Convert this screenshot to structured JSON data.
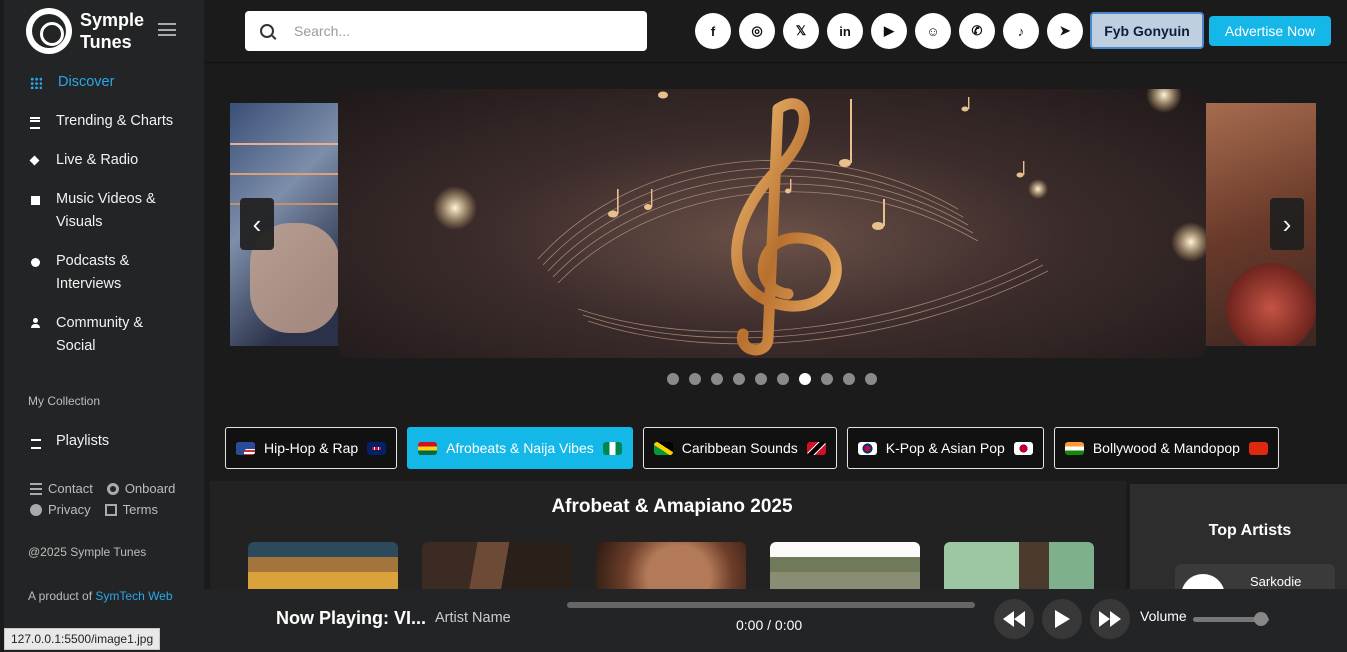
{
  "app": {
    "name_line1": "Symple",
    "name_line2": "Tunes"
  },
  "sidebar": {
    "items": [
      {
        "label": "Discover",
        "icon": "grid-icon"
      },
      {
        "label": "Trending & Charts",
        "icon": "list-icon"
      },
      {
        "label": "Live & Radio",
        "icon": "radio-icon"
      },
      {
        "label": "Music Videos & Visuals",
        "icon": "video-icon"
      },
      {
        "label": "Podcasts & Interviews",
        "icon": "podcast-icon"
      },
      {
        "label": "Community & Social",
        "icon": "user-icon"
      }
    ],
    "collection_label": "My Collection",
    "playlists_label": "Playlists",
    "links": {
      "contact": "Contact",
      "onboard": "Onboard",
      "privacy": "Privacy",
      "terms": "Terms"
    },
    "copyright": "@2025 Symple Tunes",
    "product_prefix": "A product of ",
    "product_link": "SymTech Web"
  },
  "search": {
    "placeholder": "Search..."
  },
  "socials": [
    {
      "name": "facebook-icon",
      "glyph": "f"
    },
    {
      "name": "instagram-icon",
      "glyph": "◎"
    },
    {
      "name": "x-icon",
      "glyph": "𝕏"
    },
    {
      "name": "linkedin-icon",
      "glyph": "in"
    },
    {
      "name": "youtube-icon",
      "glyph": "▶"
    },
    {
      "name": "snapchat-icon",
      "glyph": "☺"
    },
    {
      "name": "whatsapp-icon",
      "glyph": "✆"
    },
    {
      "name": "tiktok-icon",
      "glyph": "♪"
    },
    {
      "name": "telegram-icon",
      "glyph": "➤"
    }
  ],
  "header": {
    "user_button": "Fyb Gonyuin",
    "advertise_button": "Advertise Now"
  },
  "carousel": {
    "prev": "‹",
    "next": "›",
    "slide_count": 10,
    "active_index": 6
  },
  "genres": [
    {
      "label": "Hip-Hop & Rap",
      "active": false
    },
    {
      "label": "Afrobeats & Naija Vibes",
      "active": true
    },
    {
      "label": "Caribbean Sounds",
      "active": false
    },
    {
      "label": "K-Pop & Asian Pop",
      "active": false
    },
    {
      "label": "Bollywood & Mandopop",
      "active": false
    }
  ],
  "main": {
    "section_title": "Afrobeat & Amapiano 2025"
  },
  "top_artists": {
    "title": "Top Artists",
    "first": "Sarkodie"
  },
  "player": {
    "now_playing": "Now Playing: VI...",
    "artist": "Artist Name",
    "time": "0:00 / 0:00",
    "volume_label": "Volume",
    "volume_level": 0.9
  },
  "status_url": "127.0.0.1:5500/image1.jpg",
  "colors": {
    "accent": "#13b7e8",
    "sidebar": "#232425",
    "background": "#1b1b1b"
  }
}
